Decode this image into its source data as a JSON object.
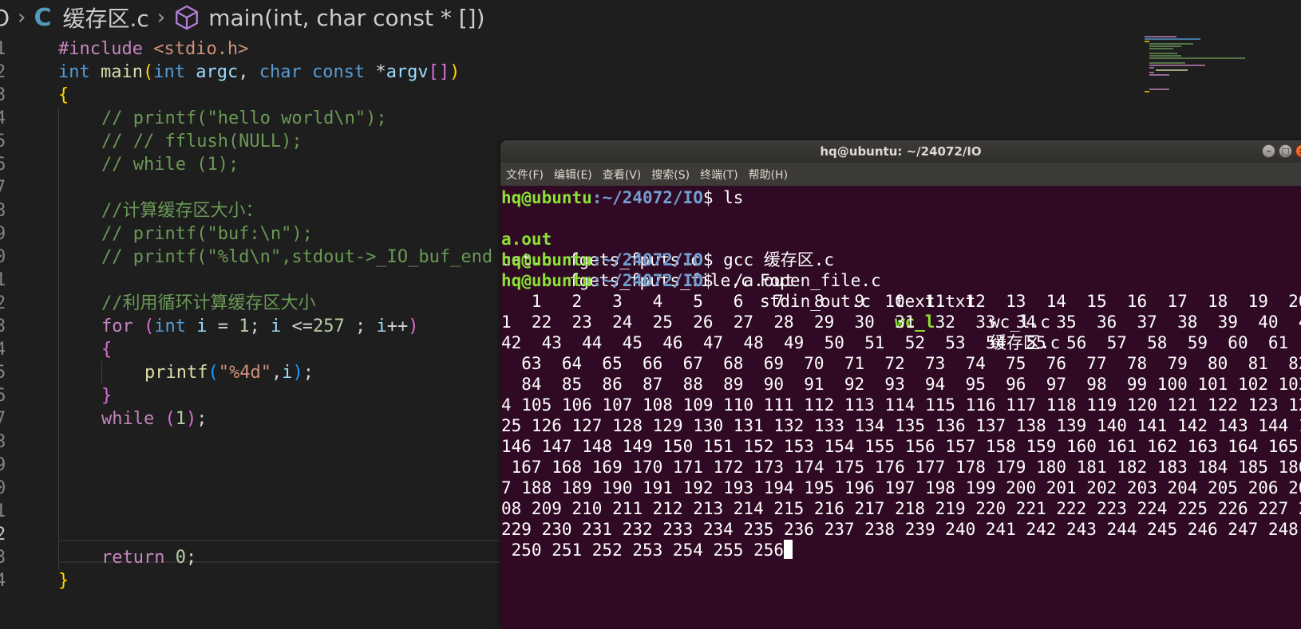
{
  "breadcrumb": {
    "folder_fragment": "O",
    "lang_icon_text": "C",
    "file": "缓存区.c",
    "symbol": "main(int, char const * [])"
  },
  "gutter": [
    "1",
    "2",
    "3",
    "4",
    "5",
    "6",
    "7",
    "8",
    "9",
    "0",
    "1",
    "2",
    "3",
    "4",
    "5",
    "6",
    "7",
    "8",
    "9",
    "0",
    "1",
    "2",
    "3",
    "4"
  ],
  "code": {
    "l1_pp": "#include",
    "l1_inc": "<stdio.h>",
    "l2_int": "int",
    "l2_main": "main",
    "l2_int2": "int",
    "l2_argc": "argc",
    "l2_char": "char",
    "l2_const": "const",
    "l2_argv": "argv",
    "l4": "// printf(\"hello world\\n\");",
    "l5": "// // fflush(NULL);",
    "l6": "// while (1);",
    "l8": "//计算缓存区大小：",
    "l9": "// printf(\"buf:\\n\");",
    "l10": "// printf(\"%ld\\n\",stdout->_IO_buf_end",
    "l12": "//利用循环计算缓存区大小",
    "l13_for": "for",
    "l13_int": "int",
    "l13_i1": "i",
    "l13_eq": " = ",
    "l13_n1": "1",
    "l13_i2": "i",
    "l13_le": " <=",
    "l13_n2": "257",
    "l13_i3": "i",
    "l13_pp": "++",
    "l15_printf": "printf",
    "l15_str": "\"%4d\"",
    "l15_i": "i",
    "l17_while": "while",
    "l17_num": "1",
    "l23_return": "return",
    "l23_num": "0"
  },
  "terminal": {
    "title": "hq@ubuntu: ~/24072/IO",
    "menu": [
      "文件(F)",
      "编辑(E)",
      "查看(V)",
      "搜索(S)",
      "终端(T)",
      "帮助(H)"
    ],
    "prompt_user": "hq@ubuntu",
    "prompt_path": ":~/24072/IO",
    "cmd1": "$ ls",
    "ls_row1": [
      "a.out",
      "fgets_fputs.c",
      "Fopen_file.c",
      "text.txt",
      "wc_l.c"
    ],
    "ls_row2": [
      "cat.c",
      "fgets_fputs_file.c",
      "stdin_out.c",
      "wc_l",
      "缓存区.c"
    ],
    "cmd2": "$ gcc 缓存区.c",
    "cmd3": "$ ./a.out",
    "output_lines": [
      "   1   2   3   4   5   6   7   8   9  10  11  12  13  14  15  16  17  18  19  20  2",
      "1  22  23  24  25  26  27  28  29  30  31  32  33  34  35  36  37  38  39  40  41  ",
      "42  43  44  45  46  47  48  49  50  51  52  53  54  55  56  57  58  59  60  61  62",
      "  63  64  65  66  67  68  69  70  71  72  73  74  75  76  77  78  79  80  81  82  83",
      "  84  85  86  87  88  89  90  91  92  93  94  95  96  97  98  99 100 101 102 103 10",
      "4 105 106 107 108 109 110 111 112 113 114 115 116 117 118 119 120 121 122 123 124 1",
      "25 126 127 128 129 130 131 132 133 134 135 136 137 138 139 140 141 142 143 144 145",
      "146 147 148 149 150 151 152 153 154 155 156 157 158 159 160 161 162 163 164 165 166",
      " 167 168 169 170 171 172 173 174 175 176 177 178 179 180 181 182 183 184 185 186 18",
      "7 188 189 190 191 192 193 194 195 196 197 198 199 200 201 202 203 204 205 206 207 2",
      "08 209 210 211 212 213 214 215 216 217 218 219 220 221 222 223 224 225 226 227 228 ",
      "229 230 231 232 233 234 235 236 237 238 239 240 241 242 243 244 245 246 247 248 249",
      " 250 251 252 253 254 255 256"
    ]
  },
  "colors": {
    "editor_bg": "#1e1e1e",
    "terminal_bg": "#300a24",
    "prompt_user": "#8ae234",
    "prompt_path": "#729fcf"
  }
}
